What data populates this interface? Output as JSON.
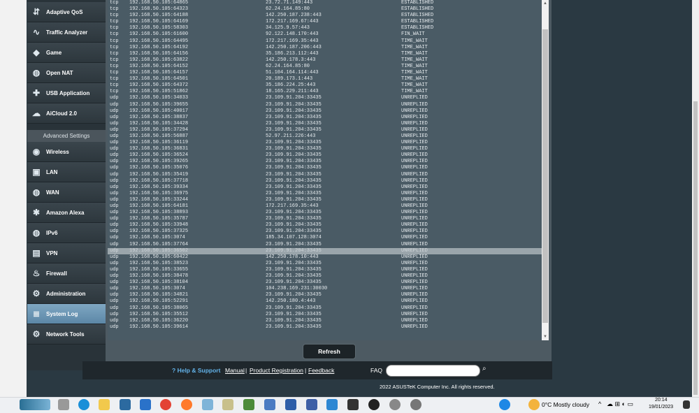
{
  "menu": {
    "top_items": [
      {
        "label": "Adaptive QoS",
        "icon": "qos-icon"
      },
      {
        "label": "Traffic Analyzer",
        "icon": "analyzer-icon"
      },
      {
        "label": "Game",
        "icon": "gamepad-icon"
      },
      {
        "label": "Open NAT",
        "icon": "globe-icon"
      },
      {
        "label": "USB Application",
        "icon": "puzzle-icon"
      },
      {
        "label": "AiCloud 2.0",
        "icon": "cloud-icon"
      }
    ],
    "advanced_header": "Advanced Settings",
    "advanced_items": [
      {
        "label": "Wireless",
        "icon": "wifi-icon"
      },
      {
        "label": "LAN",
        "icon": "lan-icon"
      },
      {
        "label": "WAN",
        "icon": "globe-icon"
      },
      {
        "label": "Amazon Alexa",
        "icon": "alexa-icon"
      },
      {
        "label": "IPv6",
        "icon": "ipv6-icon"
      },
      {
        "label": "VPN",
        "icon": "vpn-icon"
      },
      {
        "label": "Firewall",
        "icon": "firewall-icon"
      },
      {
        "label": "Administration",
        "icon": "admin-icon"
      },
      {
        "label": "System Log",
        "icon": "log-icon",
        "active": true
      },
      {
        "label": "Network Tools",
        "icon": "tools-icon"
      }
    ]
  },
  "log_rows": [
    [
      "tcp",
      "192.168.50.105:64865",
      "23.72.71.149:443",
      "ESTABLISHED"
    ],
    [
      "tcp",
      "192.168.50.105:64323",
      "62.24.164.85:80",
      "ESTABLISHED"
    ],
    [
      "tcp",
      "192.168.50.105:64188",
      "142.250.187.238:443",
      "ESTABLISHED"
    ],
    [
      "tcp",
      "192.168.50.105:64169",
      "172.217.169.67:443",
      "ESTABLISHED"
    ],
    [
      "tcp",
      "192.168.50.105:58303",
      "34.125.9.57:443",
      "ESTABLISHED"
    ],
    [
      "tcp",
      "192.168.50.105:61600",
      "92.122.148.170:443",
      "FIN_WAIT"
    ],
    [
      "tcp",
      "192.168.50.105:64495",
      "172.217.169.35:443",
      "TIME_WAIT"
    ],
    [
      "tcp",
      "192.168.50.105:64192",
      "142.250.187.206:443",
      "TIME_WAIT"
    ],
    [
      "tcp",
      "192.168.50.105:64156",
      "35.186.213.112:443",
      "TIME_WAIT"
    ],
    [
      "tcp",
      "192.168.50.105:63822",
      "142.250.178.3:443",
      "TIME_WAIT"
    ],
    [
      "tcp",
      "192.168.50.105:64152",
      "62.24.164.85:80",
      "TIME_WAIT"
    ],
    [
      "tcp",
      "192.168.50.105:64157",
      "51.104.164.114:443",
      "TIME_WAIT"
    ],
    [
      "tcp",
      "192.168.50.105:64501",
      "20.189.173.1:443",
      "TIME_WAIT"
    ],
    [
      "tcp",
      "192.168.50.105:64372",
      "35.186.224.25:443",
      "TIME_WAIT"
    ],
    [
      "tcp",
      "192.168.50.105:51862",
      "18.165.229.211:443",
      "TIME_WAIT"
    ],
    [
      "udp",
      "192.168.50.105:34033",
      "23.109.91.204:33435",
      "UNREPLIED"
    ],
    [
      "udp",
      "192.168.50.105:39655",
      "23.109.91.204:33435",
      "UNREPLIED"
    ],
    [
      "udp",
      "192.168.50.105:40017",
      "23.109.91.204:33435",
      "UNREPLIED"
    ],
    [
      "udp",
      "192.168.50.105:38837",
      "23.109.91.204:33435",
      "UNREPLIED"
    ],
    [
      "udp",
      "192.168.50.105:34428",
      "23.109.91.204:33435",
      "UNREPLIED"
    ],
    [
      "udp",
      "192.168.50.105:37294",
      "23.109.91.204:33435",
      "UNREPLIED"
    ],
    [
      "udp",
      "192.168.50.105:56887",
      "52.97.211.226:443",
      "UNREPLIED"
    ],
    [
      "udp",
      "192.168.50.105:36119",
      "23.109.91.204:33435",
      "UNREPLIED"
    ],
    [
      "udp",
      "192.168.50.105:36831",
      "23.109.91.204:33435",
      "UNREPLIED"
    ],
    [
      "udp",
      "192.168.50.105:36524",
      "23.109.91.204:33435",
      "UNREPLIED"
    ],
    [
      "udp",
      "192.168.50.105:39265",
      "23.109.91.204:33435",
      "UNREPLIED"
    ],
    [
      "udp",
      "192.168.50.105:35076",
      "23.109.91.204:33435",
      "UNREPLIED"
    ],
    [
      "udp",
      "192.168.50.105:35419",
      "23.109.91.204:33435",
      "UNREPLIED"
    ],
    [
      "udp",
      "192.168.50.105:37718",
      "23.109.91.204:33435",
      "UNREPLIED"
    ],
    [
      "udp",
      "192.168.50.105:39334",
      "23.109.91.204:33435",
      "UNREPLIED"
    ],
    [
      "udp",
      "192.168.50.105:36975",
      "23.109.91.204:33435",
      "UNREPLIED"
    ],
    [
      "udp",
      "192.168.50.105:33244",
      "23.109.91.204:33435",
      "UNREPLIED"
    ],
    [
      "udp",
      "192.168.50.105:64181",
      "172.217.169.35:443",
      "UNREPLIED"
    ],
    [
      "udp",
      "192.168.50.105:38893",
      "23.109.91.204:33435",
      "UNREPLIED"
    ],
    [
      "udp",
      "192.168.50.105:35787",
      "23.109.91.204:33435",
      "UNREPLIED"
    ],
    [
      "udp",
      "192.168.50.105:33948",
      "23.109.91.204:33435",
      "UNREPLIED"
    ],
    [
      "udp",
      "192.168.50.105:37325",
      "23.109.91.204:33435",
      "UNREPLIED"
    ],
    [
      "udp",
      "192.168.50.105:3074",
      "185.34.107.128:3074",
      "UNREPLIED"
    ],
    [
      "udp",
      "192.168.50.105:37764",
      "23.109.91.204:33435",
      "UNREPLIED"
    ],
    [
      "udp",
      "192.168.50.105:36502",
      "23.109.91.204:33435",
      "UNREPLIED"
    ],
    [
      "udp",
      "192.168.50.105:60422",
      "142.250.178.10:443",
      "UNREPLIED"
    ],
    [
      "udp",
      "192.168.50.105:38523",
      "23.109.91.204:33435",
      "UNREPLIED"
    ],
    [
      "udp",
      "192.168.50.105:33655",
      "23.109.91.204:33435",
      "UNREPLIED"
    ],
    [
      "udp",
      "192.168.50.105:38478",
      "23.109.91.204:33435",
      "UNREPLIED"
    ],
    [
      "udp",
      "192.168.50.105:38104",
      "23.109.91.204:33435",
      "UNREPLIED"
    ],
    [
      "udp",
      "192.168.50.105:3074",
      "104.238.169.231:30030",
      "UNREPLIED"
    ],
    [
      "udp",
      "192.168.50.105:34821",
      "23.109.91.204:33435",
      "UNREPLIED"
    ],
    [
      "udp",
      "192.168.50.105:52291",
      "142.250.180.4:443",
      "UNREPLIED"
    ],
    [
      "udp",
      "192.168.50.105:38065",
      "23.109.91.204:33435",
      "UNREPLIED"
    ],
    [
      "udp",
      "192.168.50.105:35512",
      "23.109.91.204:33435",
      "UNREPLIED"
    ],
    [
      "udp",
      "192.168.50.105:36220",
      "23.109.91.204:33435",
      "UNREPLIED"
    ],
    [
      "udp",
      "192.168.50.105:39614",
      "23.109.91.204:33435",
      "UNREPLIED"
    ]
  ],
  "selected_row_index": 39,
  "refresh_label": "Refresh",
  "footer": {
    "help": "Help & Support",
    "manual": "Manual",
    "sep1": "|",
    "product_registration": "Product Registration",
    "sep2": "|",
    "feedback": "Feedback",
    "faq": "FAQ",
    "copyright": "2022 ASUSTeK Computer Inc. All rights reserved."
  },
  "taskbar": {
    "weather": "0°C  Mostly cloudy",
    "time": "20:14",
    "date": "19/01/2023"
  }
}
